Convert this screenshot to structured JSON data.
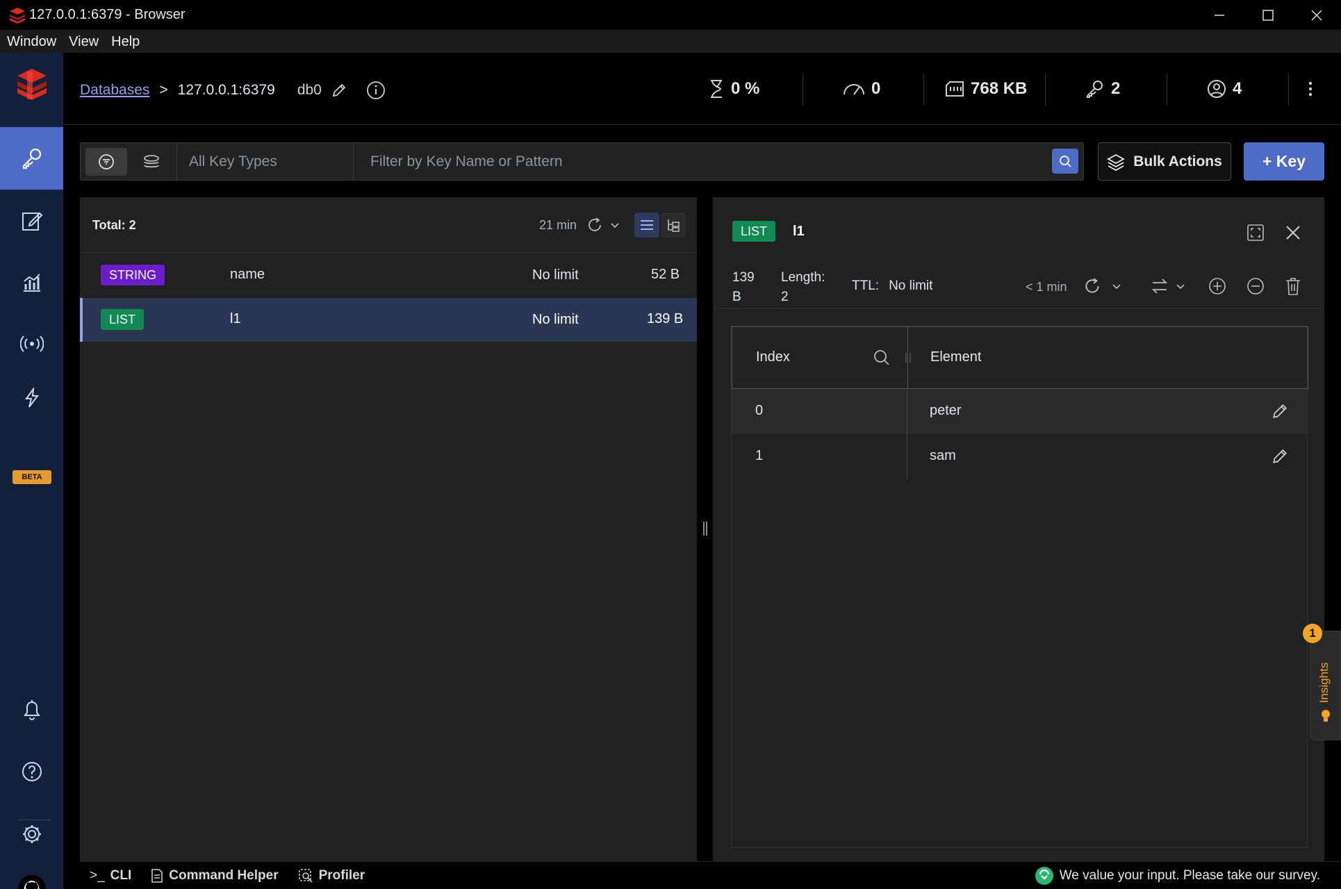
{
  "window": {
    "title": "127.0.0.1:6379 - Browser",
    "menu": [
      "Window",
      "View",
      "Help"
    ]
  },
  "header": {
    "breadcrumb_link": "Databases",
    "breadcrumb_sep": ">",
    "host": "127.0.0.1:6379",
    "db": "db0",
    "stats": {
      "cpu": "0 %",
      "ops": "0",
      "memory": "768 KB",
      "keys": "2",
      "clients": "4"
    }
  },
  "sidenav": {
    "beta_label": "BETA"
  },
  "filter": {
    "key_types": "All Key Types",
    "search_placeholder": "Filter by Key Name or Pattern",
    "bulk_actions": "Bulk Actions",
    "add_key": "+ Key"
  },
  "key_list": {
    "total": "Total: 2",
    "last_refresh": "21 min",
    "rows": [
      {
        "type": "STRING",
        "name": "name",
        "ttl": "No limit",
        "size": "52 B"
      },
      {
        "type": "LIST",
        "name": "l1",
        "ttl": "No limit",
        "size": "139 B"
      }
    ]
  },
  "details": {
    "type": "LIST",
    "key_name": "l1",
    "size_value": "139",
    "size_unit": "B",
    "length_label": "Length:",
    "length_value": "2",
    "ttl_label": "TTL:",
    "ttl_value": "No limit",
    "last_refresh": "< 1 min",
    "columns": {
      "index": "Index",
      "element": "Element"
    },
    "rows": [
      {
        "index": "0",
        "element": "peter"
      },
      {
        "index": "1",
        "element": "sam"
      }
    ]
  },
  "bottom": {
    "cli": "CLI",
    "cli_prompt": ">_",
    "command_helper": "Command Helper",
    "profiler": "Profiler",
    "survey": "We value your input. Please take our survey."
  },
  "insights": {
    "label": "Insights",
    "count": "1"
  },
  "colors": {
    "accent": "#4d6bc7",
    "string_badge": "#6a1dc9",
    "list_badge": "#0e8a52",
    "sidenav_bg": "#13203b"
  }
}
